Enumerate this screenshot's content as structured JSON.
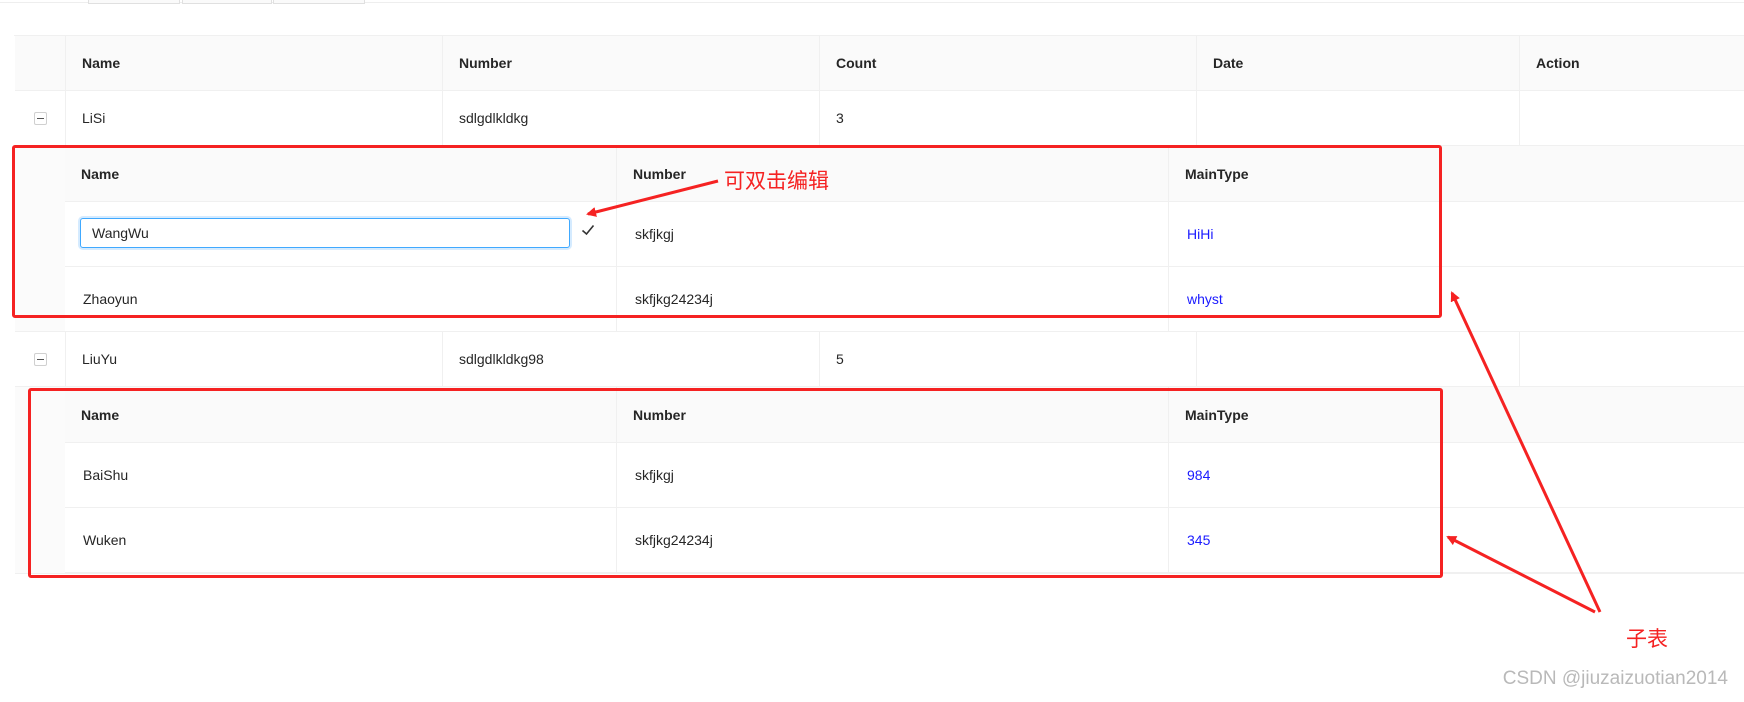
{
  "main_table": {
    "columns": [
      "Name",
      "Number",
      "Count",
      "Date",
      "Action"
    ],
    "rows": [
      {
        "name": "LiSi",
        "number": "sdlgdlkldkg",
        "count": "3",
        "date": "",
        "action": "",
        "expanded": true,
        "sub_table": {
          "columns": [
            "Name",
            "Number",
            "MainType"
          ],
          "rows": [
            {
              "name": "WangWu",
              "number": "skfjkgj",
              "main_type": "HiHi",
              "editing": true
            },
            {
              "name": "Zhaoyun",
              "number": "skfjkg24234j",
              "main_type": "whyst"
            }
          ]
        }
      },
      {
        "name": "LiuYu",
        "number": "sdlgdlkldkg98",
        "count": "5",
        "date": "",
        "action": "",
        "expanded": true,
        "sub_table": {
          "columns": [
            "Name",
            "Number",
            "MainType"
          ],
          "rows": [
            {
              "name": "BaiShu",
              "number": "skfjkgj",
              "main_type": "984"
            },
            {
              "name": "Wuken",
              "number": "skfjkg24234j",
              "main_type": "345"
            }
          ]
        }
      }
    ]
  },
  "annotations": {
    "editable_note": "可双击编辑",
    "subtable_note": "子表",
    "color": "#f52222"
  },
  "icons": {
    "expand_button": "minus-square-icon",
    "confirm_edit": "check-icon"
  },
  "link_color": "#1a1aff",
  "watermark": "CSDN @jiuzaizuotian2014"
}
